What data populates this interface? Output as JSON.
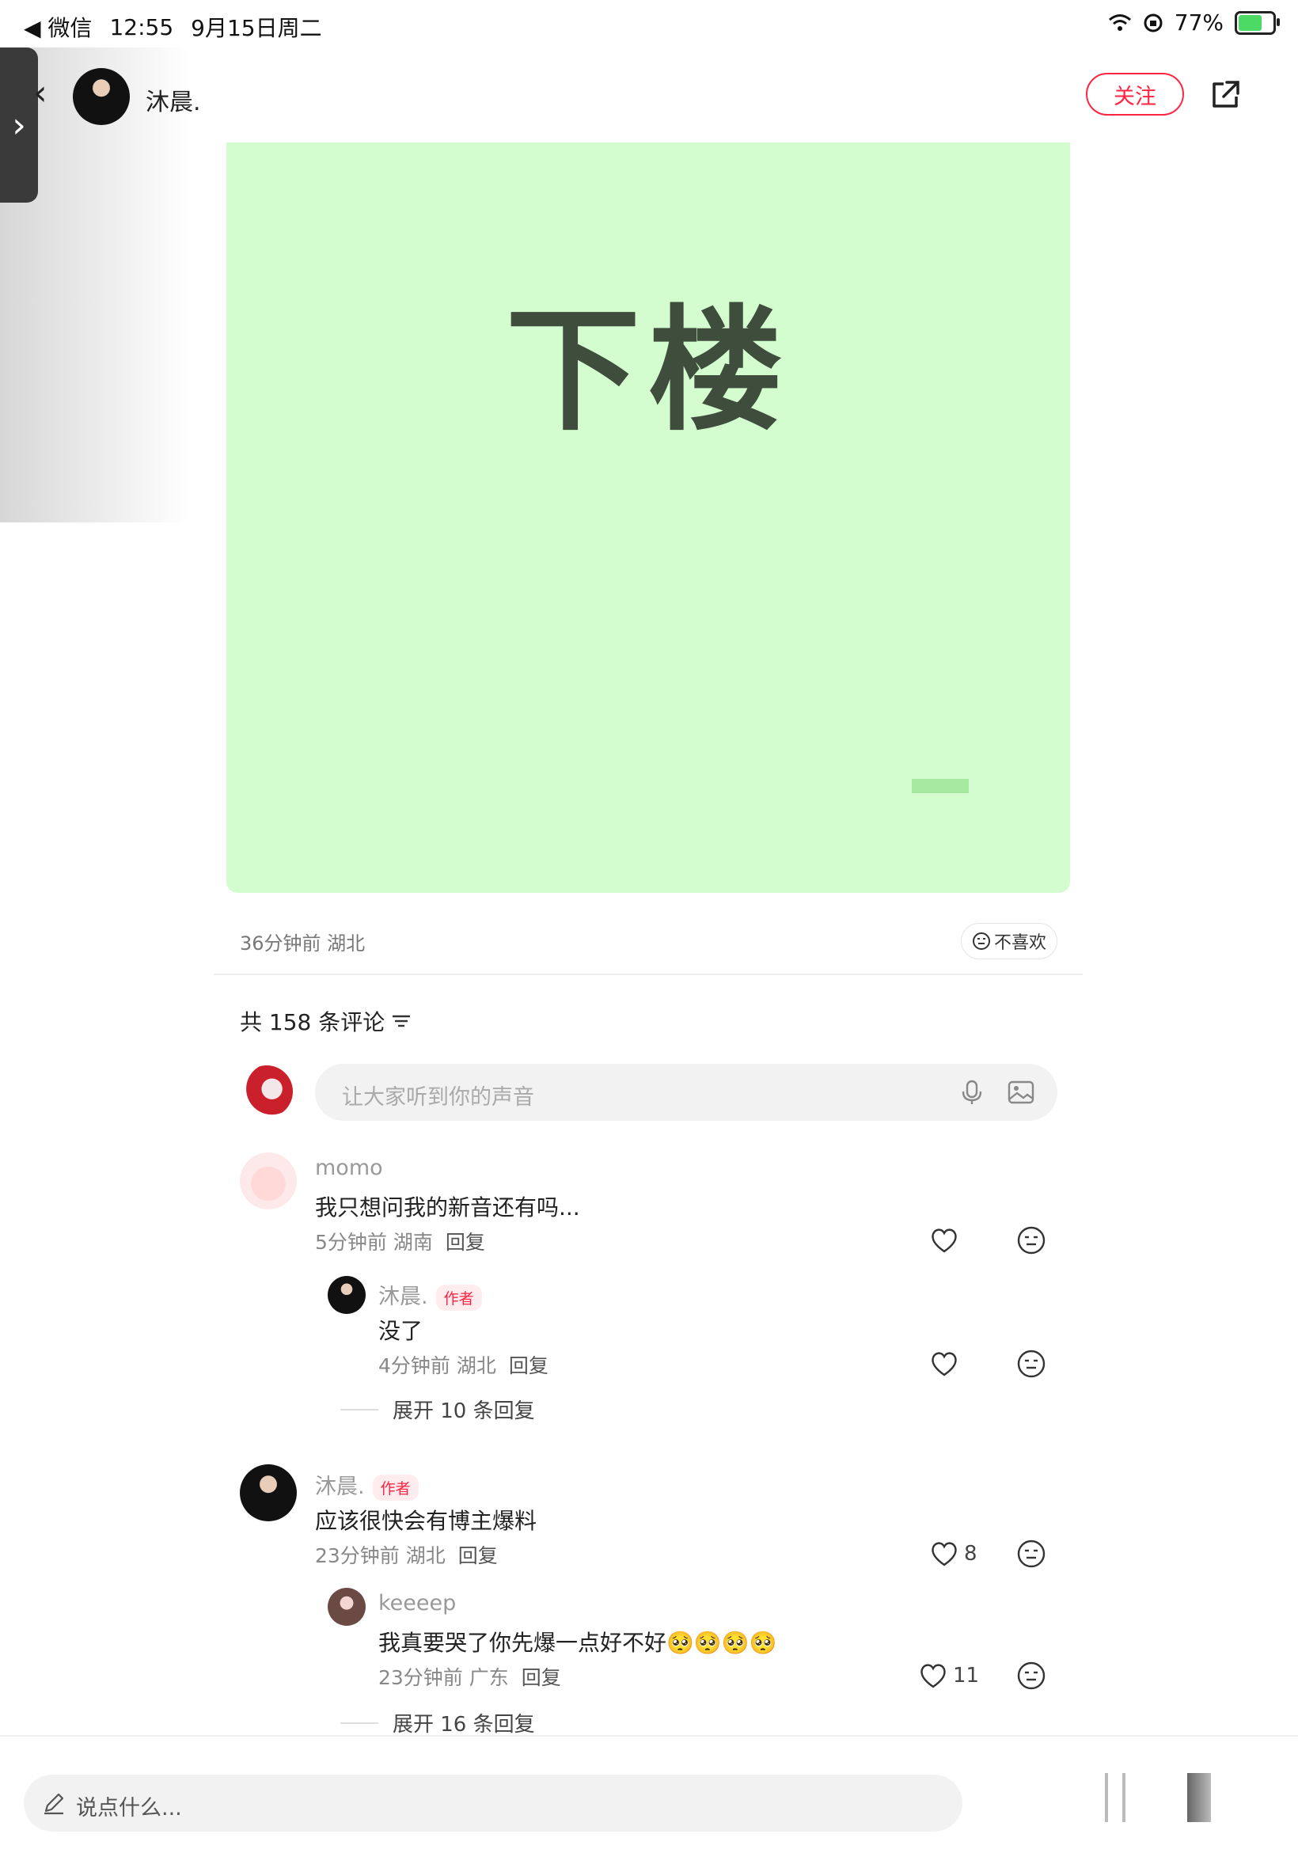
{
  "status_bar": {
    "back_app": "◀ 微信",
    "time": "12:55",
    "date": "9月15日周二",
    "battery": "77%",
    "battery_level": 0.77
  },
  "header": {
    "author_name": "沐晨.",
    "follow_label": "关注"
  },
  "post": {
    "image_text": "下楼",
    "time_location": "36分钟前 湖北",
    "dislike_label": "不喜欢"
  },
  "comments_section": {
    "count_label": "共 158 条评论",
    "input_placeholder": "让大家听到你的声音"
  },
  "comments": [
    {
      "name": "momo",
      "text": "我只想问我的新音还有吗...",
      "meta": "5分钟前 湖南",
      "reply_label": "回复",
      "likes": "",
      "replies": [
        {
          "name": "沐晨.",
          "tag": "作者",
          "text": "没了",
          "meta": "4分钟前 湖北",
          "reply_label": "回复",
          "likes": ""
        }
      ],
      "expand_label": "展开 10 条回复"
    },
    {
      "name": "沐晨.",
      "tag": "作者",
      "text": "应该很快会有博主爆料",
      "meta": "23分钟前 湖北",
      "reply_label": "回复",
      "likes": "8",
      "replies": [
        {
          "name": "keeeep",
          "text": "我真要哭了你先爆一点好不好🥺🥺🥺🥺",
          "meta": "23分钟前 广东",
          "reply_label": "回复",
          "likes": "11"
        }
      ],
      "expand_label": "展开 16 条回复"
    }
  ],
  "bottom_bar": {
    "input_placeholder": "说点什么..."
  },
  "colors": {
    "accent": "#ff2442",
    "post_bg": "#d4fdcf",
    "post_text": "#3f4d3c"
  }
}
